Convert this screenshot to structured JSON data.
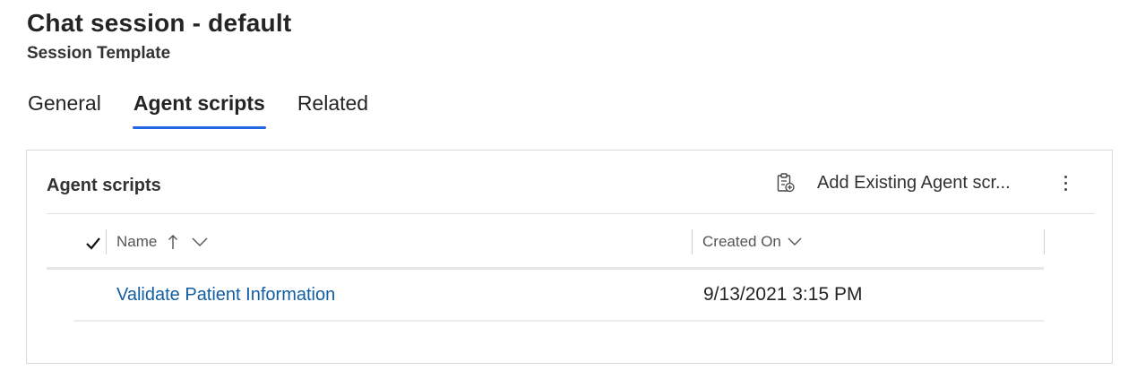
{
  "header": {
    "title": "Chat session - default",
    "subtitle": "Session Template"
  },
  "tabs": [
    {
      "label": "General",
      "active": false
    },
    {
      "label": "Agent scripts",
      "active": true
    },
    {
      "label": "Related",
      "active": false
    }
  ],
  "panel": {
    "title": "Agent scripts",
    "add_existing_label": "Add Existing Agent scr...",
    "add_existing_icon": "clipboard-add-icon",
    "more_icon": "more-vertical-icon"
  },
  "grid": {
    "columns": [
      {
        "label": "Name",
        "sorted": "ascending"
      },
      {
        "label": "Created On"
      }
    ],
    "rows": [
      {
        "name": "Validate Patient Information",
        "created_on": "9/13/2021 3:15 PM"
      }
    ]
  },
  "colors": {
    "accent": "#2266e3",
    "link": "#115ea3"
  }
}
